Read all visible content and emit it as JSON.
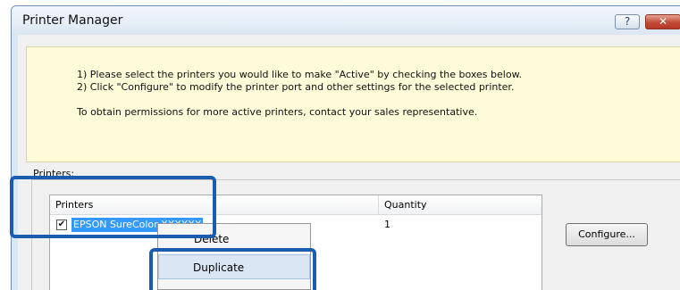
{
  "window": {
    "title": "Printer Manager",
    "help_glyph": "?",
    "close_glyph": "✕"
  },
  "info": {
    "line1": "1) Please select the printers you would like to make \"Active\" by checking the boxes below.",
    "line2": "2) Click \"Configure\" to modify the printer port and other settings for the selected printer.",
    "line3": "To obtain permissions for more active printers, contact your sales representative."
  },
  "printers_group": {
    "label": "Printers:"
  },
  "list": {
    "columns": [
      "Printers",
      "Quantity"
    ],
    "rows": [
      {
        "checked": true,
        "checkmark": "✔",
        "name": "EPSON SureColor XXXXXX",
        "quantity": "1"
      }
    ]
  },
  "buttons": {
    "configure": "Configure..."
  },
  "context_menu": {
    "items": [
      "Delete",
      "Duplicate"
    ],
    "hovered": "Duplicate"
  },
  "colors": {
    "callout": "#1a5cae",
    "selection": "#3399ff",
    "info_bg": "#fdfbd8",
    "close_button": "#c24a35"
  }
}
